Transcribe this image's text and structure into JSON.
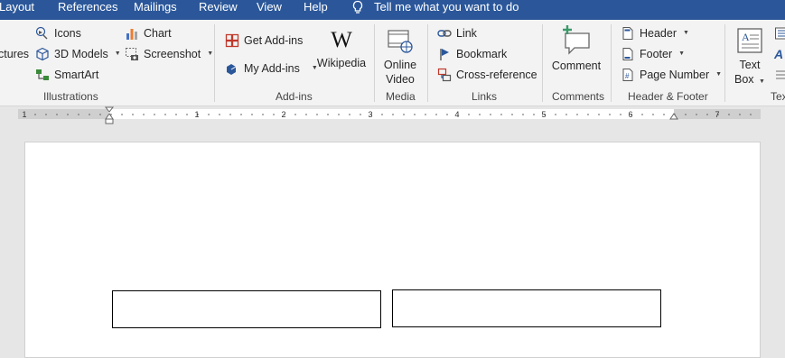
{
  "tabs": [
    "Layout",
    "References",
    "Mailings",
    "Review",
    "View",
    "Help"
  ],
  "tell_me": "Tell me what you want to do",
  "illustrations": {
    "pictures": "ctures",
    "icons": "Icons",
    "models": "3D Models",
    "smartart": "SmartArt",
    "chart": "Chart",
    "screenshot": "Screenshot",
    "group": "Illustrations"
  },
  "addins": {
    "get": "Get Add-ins",
    "my": "My Add-ins",
    "wikipedia": "Wikipedia",
    "group": "Add-ins"
  },
  "media": {
    "online_video_1": "Online",
    "online_video_2": "Video",
    "group": "Media"
  },
  "links": {
    "link": "Link",
    "bookmark": "Bookmark",
    "crossref": "Cross-reference",
    "group": "Links"
  },
  "comments": {
    "comment": "Comment",
    "group": "Comments"
  },
  "header_footer": {
    "header": "Header",
    "footer": "Footer",
    "page_number": "Page Number",
    "group": "Header & Footer"
  },
  "text": {
    "textbox_1": "Text",
    "textbox_2": "Box",
    "group": "Tex"
  },
  "ruler": {
    "numbers": [
      "1",
      "1",
      "2",
      "3",
      "4",
      "5",
      "6",
      "7"
    ]
  },
  "colors": {
    "accent": "#2b579a",
    "ribbon_bg": "#f3f3f3",
    "page_bg": "#ffffff"
  }
}
